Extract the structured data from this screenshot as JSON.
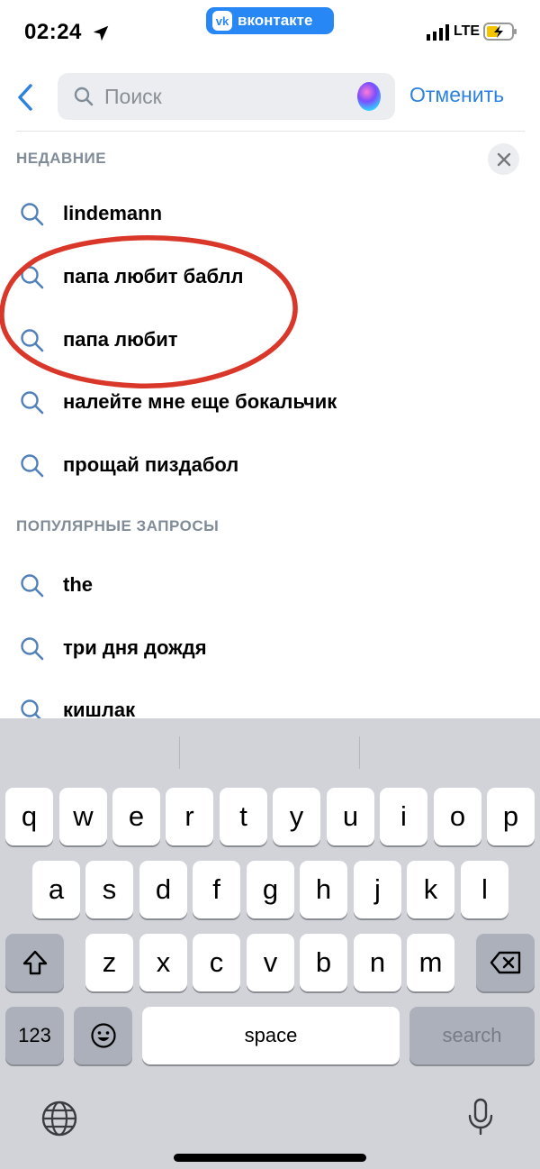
{
  "status_bar": {
    "time": "02:24",
    "app_pill": "вконтакте",
    "app_logo": "vk",
    "network": "LTE",
    "icons": [
      "location-arrow-icon",
      "signal-icon",
      "battery-charging-icon"
    ]
  },
  "search": {
    "placeholder": "Поиск",
    "value": "",
    "cancel_label": "Отменить"
  },
  "recent": {
    "title": "НЕДАВНИЕ",
    "items": [
      {
        "label": "lindemann"
      },
      {
        "label": "папа любит баблл"
      },
      {
        "label": "папа любит"
      },
      {
        "label": "налейте мне еще бокальчик"
      },
      {
        "label": "прощай пиздабол"
      }
    ]
  },
  "popular": {
    "title": "ПОПУЛЯРНЫЕ ЗАПРОСЫ",
    "items": [
      {
        "label": "the"
      },
      {
        "label": "три дня дождя"
      },
      {
        "label": "кишлак"
      }
    ]
  },
  "annotation": {
    "shape": "hand-drawn ellipse",
    "color": "#d9372a"
  },
  "keyboard": {
    "row1": [
      "q",
      "w",
      "e",
      "r",
      "t",
      "y",
      "u",
      "i",
      "o",
      "p"
    ],
    "row2": [
      "a",
      "s",
      "d",
      "f",
      "g",
      "h",
      "j",
      "k",
      "l"
    ],
    "row3": [
      "z",
      "x",
      "c",
      "v",
      "b",
      "n",
      "m"
    ],
    "numbers_label": "123",
    "space_label": "space",
    "search_label": "search"
  },
  "colors": {
    "accent": "#2d81e0",
    "section_label": "#818c99",
    "vk_blue": "#2787f5",
    "keyboard_bg": "#d1d3d9"
  }
}
